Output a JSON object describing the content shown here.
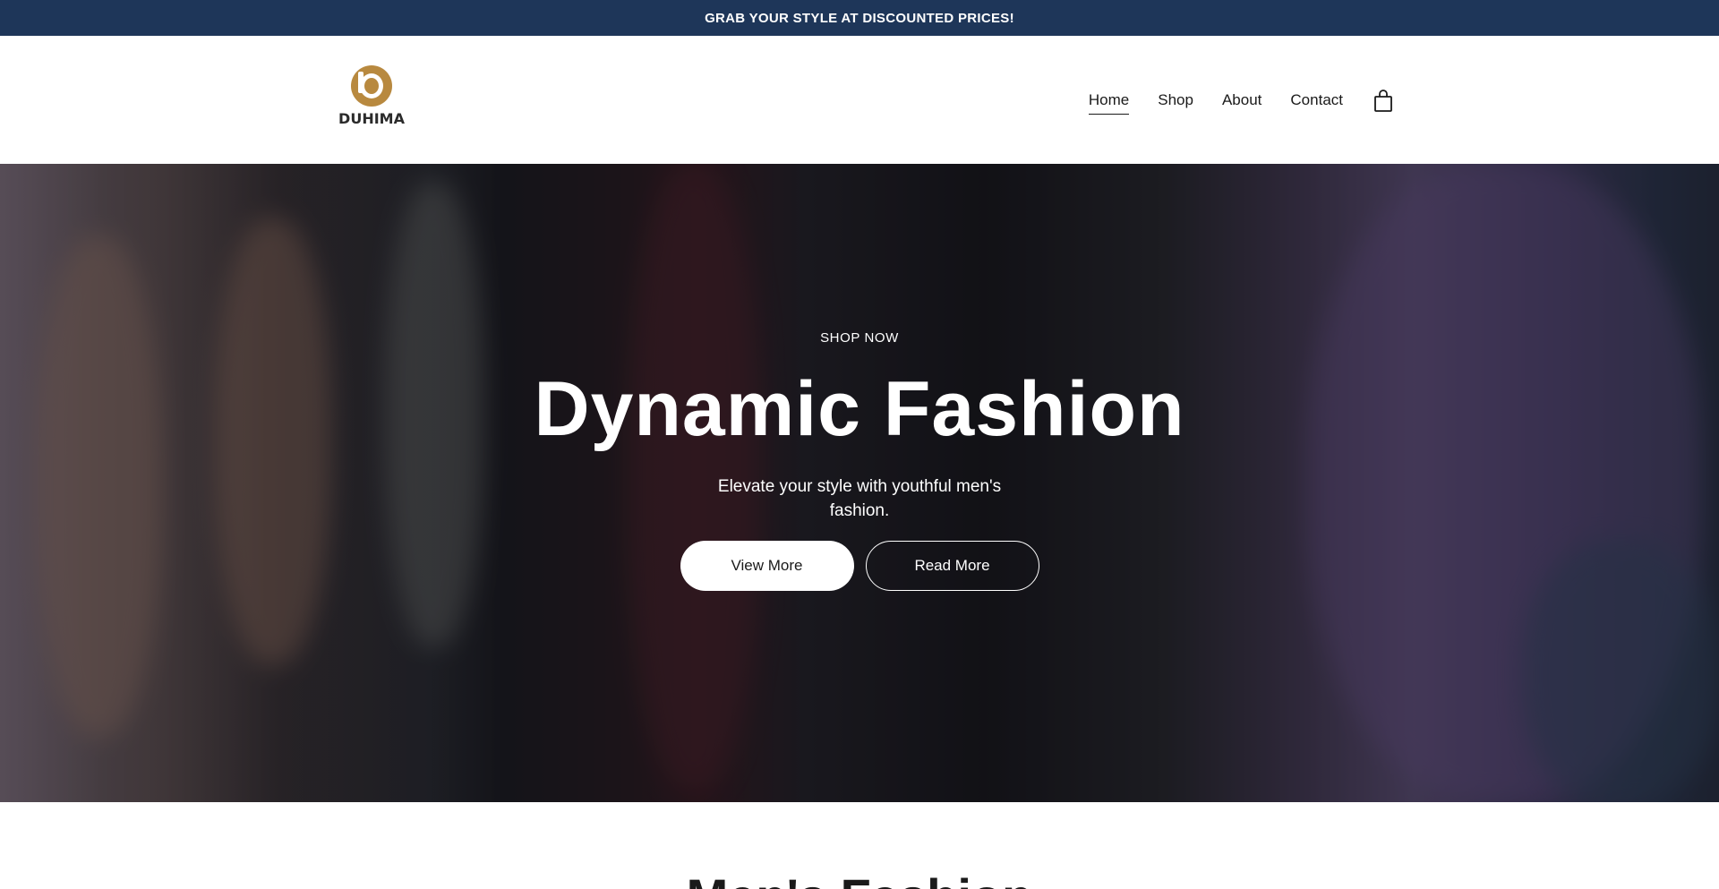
{
  "announcement": {
    "text": "GRAB YOUR STYLE AT DISCOUNTED PRICES!"
  },
  "header": {
    "logo_text": "DUHIMA",
    "logo_color": "#b8893f",
    "nav": [
      {
        "label": "Home",
        "active": true
      },
      {
        "label": "Shop",
        "active": false
      },
      {
        "label": "About",
        "active": false
      },
      {
        "label": "Contact",
        "active": false
      }
    ],
    "cart_icon": "shopping-bag-icon"
  },
  "hero": {
    "eyebrow": "SHOP NOW",
    "title": "Dynamic Fashion",
    "subtitle": "Elevate your style with youthful men's fashion.",
    "primary_button": "View More",
    "secondary_button": "Read More"
  },
  "next_section": {
    "title": "Men's Fashion"
  },
  "colors": {
    "announcement_bg": "#1e3659",
    "text": "#1a1a1a",
    "hero_text": "#ffffff"
  }
}
